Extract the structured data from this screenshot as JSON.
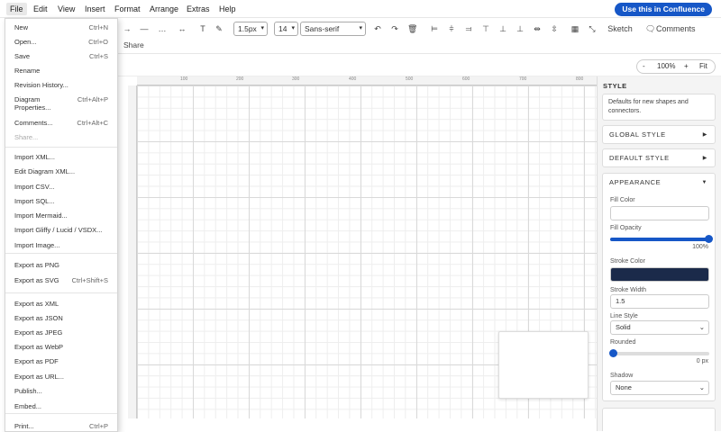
{
  "menubar": {
    "items": [
      "File",
      "Edit",
      "View",
      "Insert",
      "Format",
      "Arrange",
      "Extras",
      "Help"
    ],
    "cta": "Use this in Confluence"
  },
  "toolbar": {
    "stroke_width": "1.5px",
    "font_size": "14",
    "font_family": "Sans-serif",
    "sketch": "Sketch",
    "comments": "Comments",
    "share": "Share"
  },
  "zoom": {
    "minus": "-",
    "value": "100%",
    "plus": "+",
    "fit": "Fit"
  },
  "ruler": {
    "ticks": [
      "100",
      "200",
      "300",
      "400",
      "500",
      "600",
      "700",
      "800"
    ]
  },
  "file_menu": {
    "items": [
      {
        "label": "New",
        "shortcut": "Ctrl+N"
      },
      {
        "label": "Open...",
        "shortcut": "Ctrl+O"
      },
      {
        "label": "Save",
        "shortcut": "Ctrl+S"
      },
      {
        "label": "Rename",
        "shortcut": ""
      },
      {
        "label": "Revision History...",
        "shortcut": ""
      },
      {
        "label": "Diagram Properties...",
        "shortcut": "Ctrl+Alt+P"
      },
      {
        "label": "Comments...",
        "shortcut": "Ctrl+Alt+C"
      },
      {
        "label": "Share...",
        "shortcut": ""
      },
      {
        "label": "Import XML...",
        "shortcut": ""
      },
      {
        "label": "Edit Diagram XML...",
        "shortcut": ""
      },
      {
        "label": "Import CSV...",
        "shortcut": ""
      },
      {
        "label": "Import SQL...",
        "shortcut": ""
      },
      {
        "label": "Import Mermaid...",
        "shortcut": ""
      },
      {
        "label": "Import Gliffy / Lucid / VSDX...",
        "shortcut": ""
      },
      {
        "label": "Import Image...",
        "shortcut": ""
      },
      {
        "label": "Export as PNG",
        "shortcut": ""
      },
      {
        "label": "Export as SVG",
        "shortcut": "Ctrl+Shift+S"
      },
      {
        "label": "Export as XML",
        "shortcut": ""
      },
      {
        "label": "Export as JSON",
        "shortcut": ""
      },
      {
        "label": "Export as JPEG",
        "shortcut": ""
      },
      {
        "label": "Export as WebP",
        "shortcut": ""
      },
      {
        "label": "Export as PDF",
        "shortcut": ""
      },
      {
        "label": "Export as URL...",
        "shortcut": ""
      },
      {
        "label": "Publish...",
        "shortcut": ""
      },
      {
        "label": "Embed...",
        "shortcut": ""
      },
      {
        "label": "Print...",
        "shortcut": "Ctrl+P"
      }
    ]
  },
  "panel": {
    "title": "STYLE",
    "intro": "Defaults for new shapes and connectors.",
    "global_style": "GLOBAL STYLE",
    "default_style": "DEFAULT STYLE",
    "appearance": "APPEARANCE",
    "fill_color_label": "Fill Color",
    "fill_opacity_label": "Fill Opacity",
    "fill_opacity_value": "100%",
    "fill_opacity_level": 1.0,
    "stroke_color_label": "Stroke Color",
    "stroke_color": "#1b2a4a",
    "stroke_width_label": "Stroke Width",
    "stroke_width_value": "1.5",
    "line_style_label": "Line Style",
    "line_style_value": "Solid",
    "rounded_label": "Rounded",
    "rounded_value": "0 px",
    "rounded_level": 0,
    "shadow_label": "Shadow",
    "shadow_value": "None"
  },
  "colors": {
    "accent": "#1657c7",
    "stroke_swatch": "#1b2a4a"
  }
}
